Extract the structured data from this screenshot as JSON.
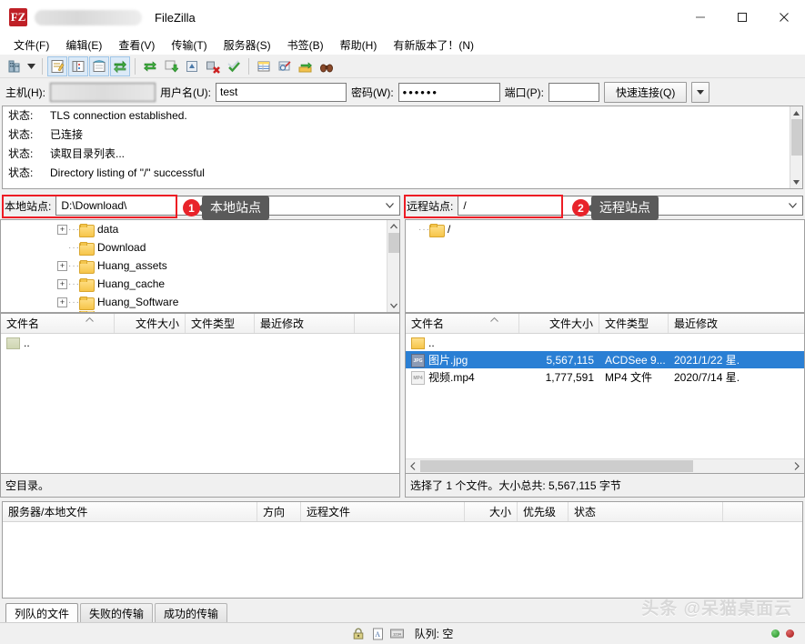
{
  "window": {
    "title": "FileZilla",
    "app_icon": "filezilla-logo",
    "minimize": "–",
    "maximize": "□",
    "close": "✕"
  },
  "menu": [
    {
      "label": "文件(F)",
      "name": "menu-file"
    },
    {
      "label": "编辑(E)",
      "name": "menu-edit"
    },
    {
      "label": "查看(V)",
      "name": "menu-view"
    },
    {
      "label": "传输(T)",
      "name": "menu-transfer"
    },
    {
      "label": "服务器(S)",
      "name": "menu-server"
    },
    {
      "label": "书签(B)",
      "name": "menu-bookmarks"
    },
    {
      "label": "帮助(H)",
      "name": "menu-help"
    },
    {
      "label": "有新版本了！(N)",
      "name": "menu-new-version"
    }
  ],
  "quickconnect": {
    "host_label": "主机(H):",
    "host_value": "",
    "user_label": "用户名(U):",
    "user_value": "test",
    "pass_label": "密码(W):",
    "pass_value": "••••••",
    "port_label": "端口(P):",
    "port_value": "",
    "connect_label": "快速连接(Q)",
    "dropdown_icon": "chevron-down-icon"
  },
  "log": {
    "rows": [
      {
        "kind": "状态:",
        "text": "TLS connection established."
      },
      {
        "kind": "状态:",
        "text": "已连接"
      },
      {
        "kind": "状态:",
        "text": "读取目录列表..."
      },
      {
        "kind": "状态:",
        "text": "Directory listing of \"/\" successful"
      }
    ]
  },
  "sitebar": {
    "local_label": "本地站点:",
    "local_value": "D:\\Download\\",
    "remote_label": "远程站点:",
    "remote_value": "/",
    "callout_1_number": "1",
    "callout_1_text": "本地站点",
    "callout_2_number": "2",
    "callout_2_text": "远程站点",
    "highlight_color": "#ed1c24",
    "badge_color": "#e8232a",
    "tooltip_color": "#5a5a5a"
  },
  "local_tree": {
    "items": [
      {
        "label": "data",
        "expandable": true
      },
      {
        "label": "Download",
        "expandable": false
      },
      {
        "label": "Huang_assets",
        "expandable": true
      },
      {
        "label": "Huang_cache",
        "expandable": true
      },
      {
        "label": "Huang_Software",
        "expandable": true
      }
    ]
  },
  "remote_tree": {
    "items": [
      {
        "label": "/",
        "expandable": false
      }
    ]
  },
  "local_list": {
    "columns": [
      "文件名",
      "文件大小",
      "文件类型",
      "最近修改"
    ],
    "rows": [
      {
        "icon": "up-folder-icon",
        "name": "..",
        "size": "",
        "type": "",
        "modified": ""
      }
    ],
    "status": "空目录。"
  },
  "remote_list": {
    "columns": [
      "文件名",
      "文件大小",
      "文件类型",
      "最近修改"
    ],
    "rows": [
      {
        "icon": "folder-icon",
        "name": "..",
        "size": "",
        "type": "",
        "modified": "",
        "selected": false
      },
      {
        "icon": "jpg-file-icon",
        "name": "图片.jpg",
        "size": "5,567,115",
        "type": "ACDSee 9...",
        "modified": "2021/1/22 星.",
        "selected": true
      },
      {
        "icon": "mp4-file-icon",
        "name": "视频.mp4",
        "size": "1,777,591",
        "type": "MP4 文件",
        "modified": "2020/7/14 星.",
        "selected": false
      }
    ],
    "status": "选择了 1 个文件。大小总共: 5,567,115 字节"
  },
  "queue": {
    "columns": [
      "服务器/本地文件",
      "方向",
      "远程文件",
      "大小",
      "优先级",
      "状态"
    ]
  },
  "tabs": [
    {
      "label": "列队的文件",
      "active": true
    },
    {
      "label": "失败的传输",
      "active": false
    },
    {
      "label": "成功的传输",
      "active": false
    }
  ],
  "bottom": {
    "lock_icon": "lock-icon",
    "cert_icon": "certificate-icon",
    "speed_icon": "speed-icon",
    "queue_label": "队列: 空",
    "led_green": "#1e8b1e",
    "led_red": "#a31414"
  },
  "watermark": "头条 @呆猫桌面云"
}
